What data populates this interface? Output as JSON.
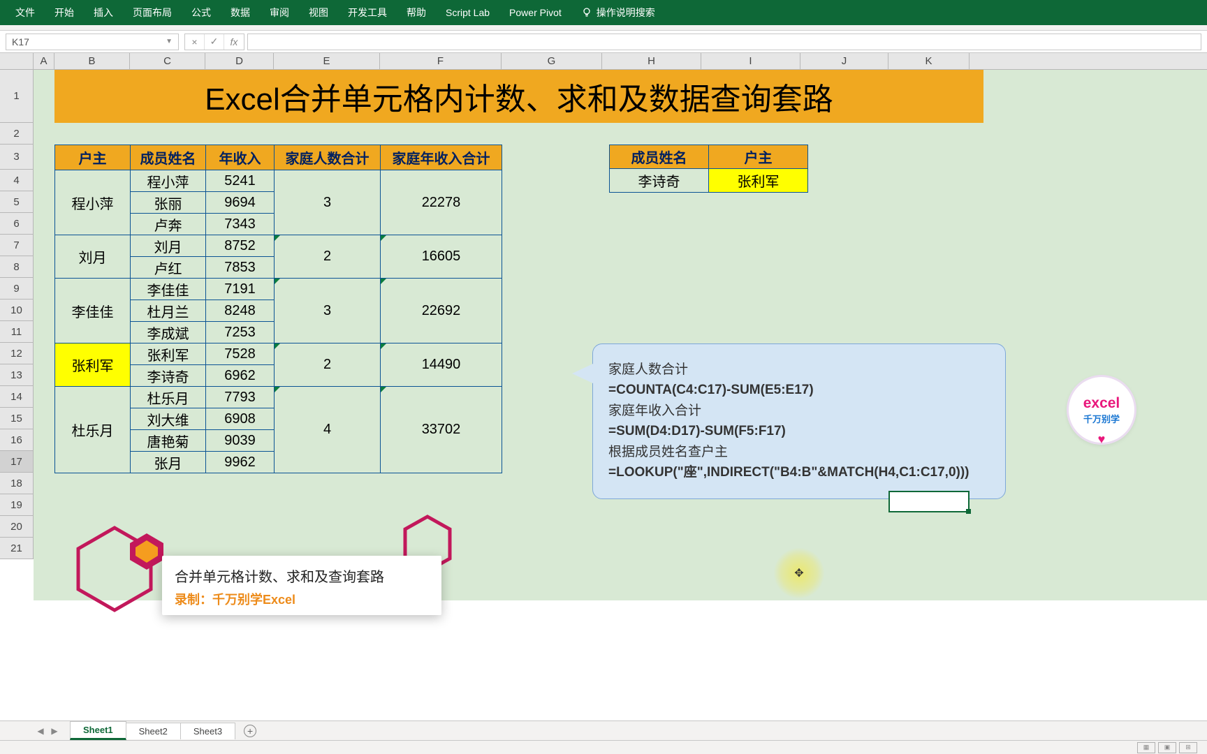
{
  "ribbon": {
    "tabs": [
      "文件",
      "开始",
      "插入",
      "页面布局",
      "公式",
      "数据",
      "审阅",
      "视图",
      "开发工具",
      "帮助",
      "Script Lab",
      "Power Pivot"
    ],
    "tell_me": "操作说明搜索"
  },
  "name_box": "K17",
  "fx_buttons": {
    "cancel": "×",
    "confirm": "✓",
    "fx": "fx"
  },
  "columns": [
    "A",
    "B",
    "C",
    "D",
    "E",
    "F",
    "G",
    "H",
    "I",
    "J",
    "K"
  ],
  "rows": [
    "1",
    "2",
    "3",
    "4",
    "5",
    "6",
    "7",
    "8",
    "9",
    "10",
    "11",
    "12",
    "13",
    "14",
    "15",
    "16",
    "17",
    "18",
    "19",
    "20",
    "21"
  ],
  "title": "Excel合并单元格内计数、求和及数据查询套路",
  "main_headers": [
    "户主",
    "成员姓名",
    "年收入",
    "家庭人数合计",
    "家庭年收入合计"
  ],
  "groups": [
    {
      "owner": "程小萍",
      "hl": false,
      "members": [
        {
          "n": "程小萍",
          "i": "5241"
        },
        {
          "n": "张丽",
          "i": "9694"
        },
        {
          "n": "卢奔",
          "i": "7343"
        }
      ],
      "count": "3",
      "sum": "22278"
    },
    {
      "owner": "刘月",
      "hl": false,
      "members": [
        {
          "n": "刘月",
          "i": "8752"
        },
        {
          "n": "卢红",
          "i": "7853"
        }
      ],
      "count": "2",
      "sum": "16605"
    },
    {
      "owner": "李佳佳",
      "hl": false,
      "members": [
        {
          "n": "李佳佳",
          "i": "7191"
        },
        {
          "n": "杜月兰",
          "i": "8248"
        },
        {
          "n": "李成斌",
          "i": "7253"
        }
      ],
      "count": "3",
      "sum": "22692"
    },
    {
      "owner": "张利军",
      "hl": true,
      "members": [
        {
          "n": "张利军",
          "i": "7528"
        },
        {
          "n": "李诗奇",
          "i": "6962"
        }
      ],
      "count": "2",
      "sum": "14490"
    },
    {
      "owner": "杜乐月",
      "hl": false,
      "members": [
        {
          "n": "杜乐月",
          "i": "7793"
        },
        {
          "n": "刘大维",
          "i": "6908"
        },
        {
          "n": "唐艳菊",
          "i": "9039"
        },
        {
          "n": "张月",
          "i": "9962"
        }
      ],
      "count": "4",
      "sum": "33702"
    }
  ],
  "lookup": {
    "headers": [
      "成员姓名",
      "户主"
    ],
    "row": {
      "name": "李诗奇",
      "owner": "张利军"
    }
  },
  "callout": {
    "l1": "家庭人数合计",
    "f1": "=COUNTA(C4:C17)-SUM(E5:E17)",
    "l2": "家庭年收入合计",
    "f2": "=SUM(D4:D17)-SUM(F5:F17)",
    "l3": "根据成员姓名查户主",
    "f3": "=LOOKUP(\"座\",INDIRECT(\"B4:B\"&MATCH(H4,C1:C17,0)))"
  },
  "logo": {
    "l1": "excel",
    "l2": "千万别学"
  },
  "overlay": {
    "t1": "合并单元格计数、求和及查询套路",
    "t2": "录制：千万别学Excel"
  },
  "sheets": [
    "Sheet1",
    "Sheet2",
    "Sheet3"
  ],
  "active_sheet": 0,
  "cursor_glyph": "✥"
}
